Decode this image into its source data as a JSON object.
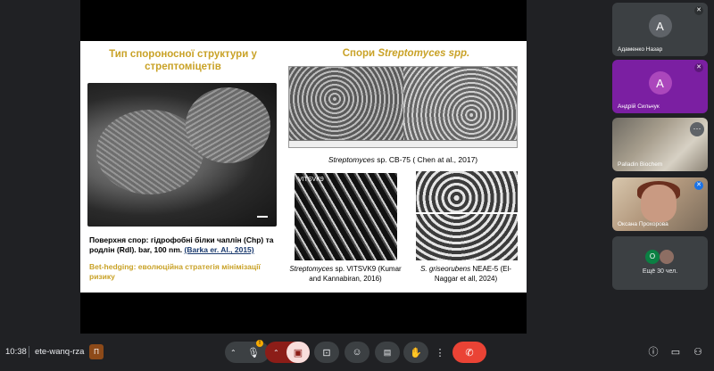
{
  "slide": {
    "title_left": "Тип спороносної структури у стрептоміцетів",
    "title_right_prefix": "Спори ",
    "title_right_italic": "Streptomyces spp.",
    "left_caption": "Поверхня спор: гідрофобні білки чаплін (Chp) та родлін (Rdl). bar, 100 nm. ",
    "left_ref": "(Barka er. Al., 2015)",
    "bet_hedging": "Bet-hedging: еволюційна стратегія мінімізації ризику",
    "wide_caption_italic": "Streptomyces",
    "wide_caption_rest": " sp. CB-75 ( Chen at al., 2017)",
    "img_a_tag": "VITSVK9",
    "cap_a_italic": "Streptomyces",
    "cap_a_rest": " sp. VITSVK9 (Kumar and Kannabiran, 2016)",
    "cap_b_italic": "S. griseorubens",
    "cap_b_rest": " NEAE-5 (El-Naggar et all, 2024)"
  },
  "participants": [
    {
      "name": "Адаменко Назар",
      "initial": "А",
      "muted": true
    },
    {
      "name": "Андрій Сильчук",
      "initial": "А",
      "muted": true
    },
    {
      "name": "Palladin Biochem",
      "muted": false
    },
    {
      "name": "Оксана Прохорова",
      "muted": true
    },
    {
      "name": "Ещё 30 чел.",
      "initials": [
        "O",
        ""
      ]
    }
  ],
  "bottombar": {
    "time": "10:38",
    "meeting_code": "ete-wanq-rza",
    "app_badge": "П",
    "controls": {
      "mic_icon": "mic-icon",
      "camera_icon": "camera-off-icon",
      "present_icon": "present-icon",
      "emoji_icon": "emoji-icon",
      "captions_icon": "captions-icon",
      "hand_icon": "raise-hand-icon",
      "more_icon": "more-vert-icon",
      "leave_icon": "call-end-icon"
    }
  },
  "colors": {
    "background": "#202124",
    "slide_title": "#c9a227",
    "leave": "#ea4335",
    "camera_off": "#8c1d18"
  }
}
